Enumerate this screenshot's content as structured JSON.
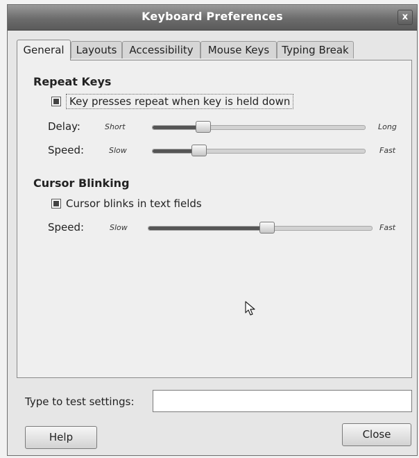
{
  "window": {
    "title": "Keyboard Preferences",
    "close_glyph": "x"
  },
  "tabs": [
    {
      "label": "General",
      "active": true
    },
    {
      "label": "Layouts",
      "active": false
    },
    {
      "label": "Accessibility",
      "active": false
    },
    {
      "label": "Mouse Keys",
      "active": false
    },
    {
      "label": "Typing Break",
      "active": false
    }
  ],
  "repeat_keys": {
    "heading": "Repeat Keys",
    "checkbox_label": "Key presses repeat when key is held down",
    "checked": true,
    "delay": {
      "label": "Delay:",
      "min_label": "Short",
      "max_label": "Long",
      "value": 0.24
    },
    "speed": {
      "label": "Speed:",
      "min_label": "Slow",
      "max_label": "Fast",
      "value": 0.22
    }
  },
  "cursor_blinking": {
    "heading": "Cursor Blinking",
    "checkbox_label": "Cursor blinks in text fields",
    "checked": true,
    "speed": {
      "label": "Speed:",
      "min_label": "Slow",
      "max_label": "Fast",
      "value": 0.53
    }
  },
  "test": {
    "label": "Type to test settings:",
    "value": ""
  },
  "buttons": {
    "help": "Help",
    "close": "Close"
  },
  "icons": {
    "pointer": "mouse-pointer-icon"
  }
}
